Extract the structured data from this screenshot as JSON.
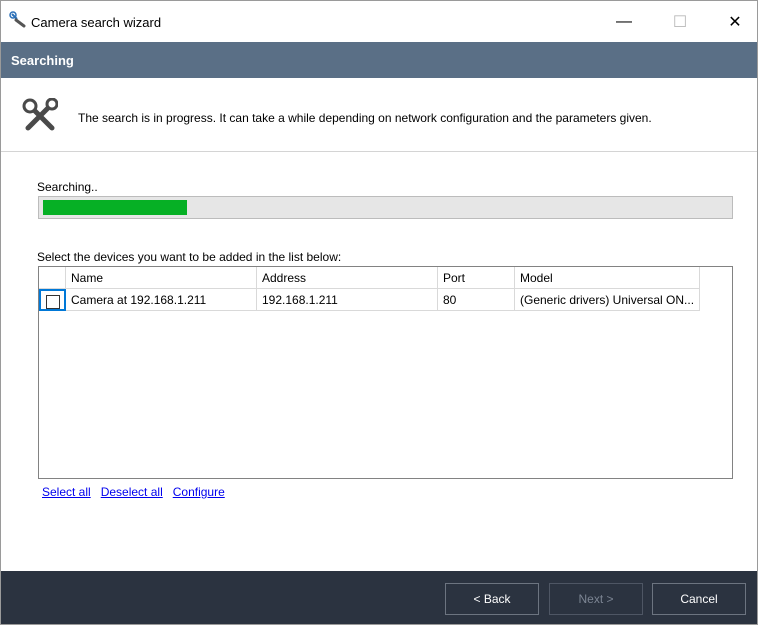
{
  "window": {
    "title": "Camera search wizard",
    "minimize_glyph": "—",
    "maximize_glyph": "☐",
    "close_glyph": "✕",
    "icon": "wrench-icon"
  },
  "step": {
    "title": "Searching",
    "description": "The search is in progress. It can take a while depending on network configuration and the parameters given.",
    "icon": "tools-icon"
  },
  "search": {
    "status": "Searching..",
    "progress_fraction": 0.21,
    "progress_color": "#06b025"
  },
  "devices": {
    "label": "Select the devices you want to be added in the list below:",
    "columns": [
      "Name",
      "Address",
      "Port",
      "Model"
    ],
    "rows": [
      {
        "checked": false,
        "name": "Camera at 192.168.1.211",
        "address": "192.168.1.211",
        "port": "80",
        "model": "(Generic drivers) Universal ON..."
      }
    ]
  },
  "links": {
    "select_all": "Select all",
    "deselect_all": "Deselect all",
    "configure": "Configure"
  },
  "footer": {
    "back": "< Back",
    "next": "Next >",
    "cancel": "Cancel"
  },
  "colors": {
    "header_bg": "#5a6f86",
    "footer_bg": "#2b3340",
    "link": "#0000ee"
  }
}
